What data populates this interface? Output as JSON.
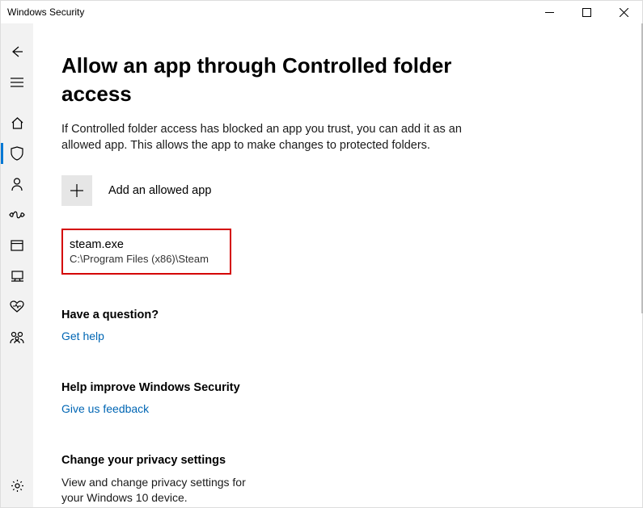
{
  "titlebar": {
    "title": "Windows Security"
  },
  "page": {
    "heading": "Allow an app through Controlled folder access",
    "description": "If Controlled folder access has blocked an app you trust, you can add it as an allowed app. This allows the app to make changes to protected folders.",
    "add_label": "Add an allowed app"
  },
  "apps": [
    {
      "name": "steam.exe",
      "path": "C:\\Program Files (x86)\\Steam"
    }
  ],
  "help": {
    "question_heading": "Have a question?",
    "get_help": "Get help",
    "improve_heading": "Help improve Windows Security",
    "feedback": "Give us feedback",
    "privacy_heading": "Change your privacy settings",
    "privacy_desc": "View and change privacy settings for your Windows 10 device."
  }
}
